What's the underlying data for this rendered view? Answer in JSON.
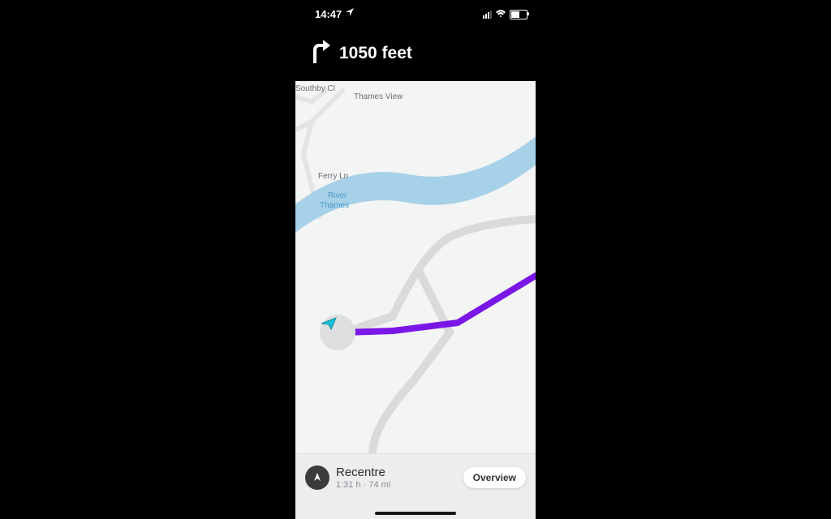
{
  "status": {
    "time": "14:47"
  },
  "direction": {
    "distance": "1050 feet"
  },
  "map_labels": {
    "southby": "Southby Cl",
    "thames_view": "Thames View",
    "ferry_ln": "Ferry Ln",
    "river": "River",
    "thames": "Thames"
  },
  "bottom": {
    "recentre": "Recentre",
    "eta_summary": "1:31 h · 74 mi",
    "overview": "Overview"
  }
}
